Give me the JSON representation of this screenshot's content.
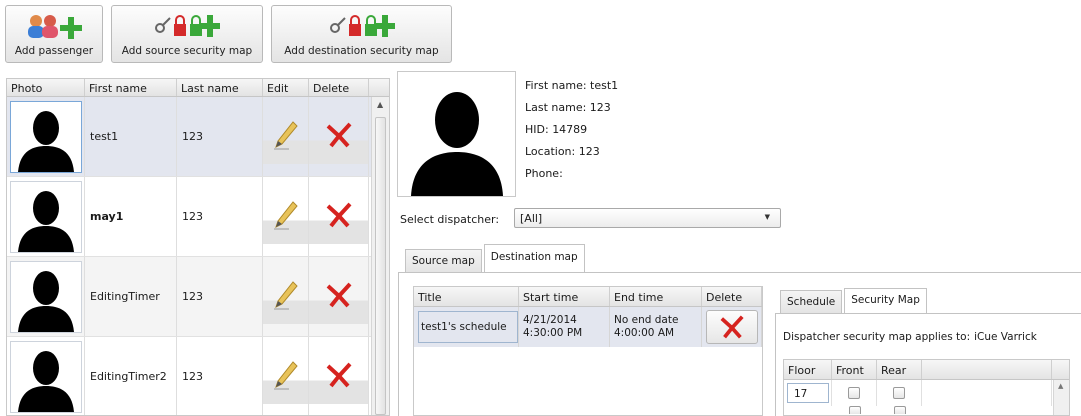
{
  "toolbar": {
    "add_passenger": "Add passenger",
    "add_source_map": "Add source security map",
    "add_destination_map": "Add destination security map"
  },
  "passenger_list": {
    "columns": [
      "Photo",
      "First name",
      "Last name",
      "Edit",
      "Delete"
    ],
    "rows": [
      {
        "first": "test1",
        "last": "123"
      },
      {
        "first": "may1",
        "last": "123"
      },
      {
        "first": "EditingTimer",
        "last": "123"
      },
      {
        "first": "EditingTimer2",
        "last": "123"
      }
    ]
  },
  "details": {
    "first_name": "First name: test1",
    "last_name": "Last name: 123",
    "hid": "HID: 14789",
    "location": "Location: 123",
    "phone": "Phone:"
  },
  "dispatcher": {
    "label": "Select dispatcher:",
    "value": "[All]"
  },
  "tabs": {
    "source": "Source map",
    "destination": "Destination map"
  },
  "schedule_grid": {
    "columns": [
      "Title",
      "Start time",
      "End time",
      "Delete"
    ],
    "rows": [
      {
        "title": "test1's schedule",
        "start_date": "4/21/2014",
        "start_time": "4:30:00 PM",
        "end_date": "No end date",
        "end_time": "4:00:00 AM"
      }
    ]
  },
  "sub_tabs": {
    "schedule": "Schedule",
    "security_map": "Security Map"
  },
  "security_map": {
    "applies_label": "Dispatcher security map applies to:",
    "applies_value": "iCue Varrick",
    "columns": [
      "Floor",
      "Front",
      "Rear"
    ],
    "rows": [
      {
        "floor": "17"
      }
    ]
  },
  "colors": {
    "selected_row": "#e3e6ef",
    "delete_red": "#d6231f",
    "add_green": "#3aa83a",
    "lock_red": "#d42a2a"
  },
  "icons": {
    "add_passenger": "people-plus-icon",
    "security_map": "key-lock-plus-icon",
    "edit": "pencil-icon",
    "delete": "red-x-icon"
  }
}
